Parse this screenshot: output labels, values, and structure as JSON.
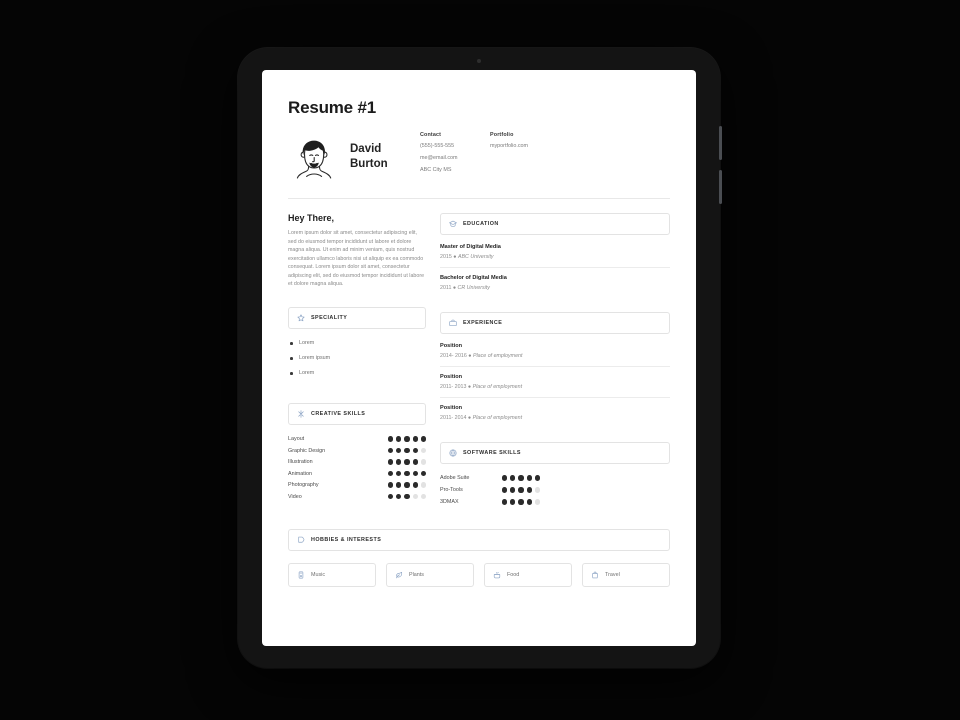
{
  "document": {
    "title": "Resume #1"
  },
  "header": {
    "avatar_alt": "avatar",
    "name_first": "David",
    "name_last": "Burton",
    "contact": {
      "heading": "Contact",
      "phone": "(555)-555-555",
      "email": "me@email.com",
      "address": "ABC City MS"
    },
    "portfolio": {
      "heading": "Portfolio",
      "url": "myportfolio.com"
    }
  },
  "intro": {
    "title": "Hey There,",
    "body": "Lorem ipsum dolor sit amet, consectetur adipiscing elit, sed do eiusmod tempor incididunt ut labore et dolore magna aliqua. Ut enim ad minim veniam, quis nostrud exercitation ullamco laboris nisi ut aliquip ex ea commodo consequat. Lorem ipsum dolor sit amet, consectetur adipiscing elit, sed do eiusmod tempor incididunt ut labore et dolore magna aliqua."
  },
  "education": {
    "label": "EDUCATION",
    "icon": "graduation-cap-icon",
    "entries": [
      {
        "degree": "Master of Digital Media",
        "year": "2015",
        "school": "ABC University"
      },
      {
        "degree": "Bachelor of Digital Media",
        "year": "2011",
        "school": "CR University"
      }
    ]
  },
  "experience": {
    "label": "EXPERIENCE",
    "icon": "briefcase-icon",
    "entries": [
      {
        "role": "Position",
        "years": "2014- 2016",
        "place": "Place of employment"
      },
      {
        "role": "Position",
        "years": "2011- 2013",
        "place": "Place of employment"
      },
      {
        "role": "Position",
        "years": "2011- 2014",
        "place": "Place of employment"
      }
    ]
  },
  "speciality": {
    "label": "SPECIALITY",
    "icon": "star-icon",
    "items": [
      "Lorem",
      "Lorem ipsum",
      "Lorem"
    ]
  },
  "creative_skills": {
    "label": "CREATIVE SKILLS",
    "icon": "spark-icon",
    "max": 5,
    "items": [
      {
        "name": "Layout",
        "value": 5
      },
      {
        "name": "Graphic Design",
        "value": 4
      },
      {
        "name": "Illustration",
        "value": 4
      },
      {
        "name": "Animation",
        "value": 5
      },
      {
        "name": "Photography",
        "value": 4
      },
      {
        "name": "Video",
        "value": 3
      }
    ]
  },
  "software_skills": {
    "label": "SOFTWARE SKILLS",
    "icon": "globe-icon",
    "max": 5,
    "items": [
      {
        "name": "Adobe Suite",
        "value": 5
      },
      {
        "name": "Pro-Tools",
        "value": 4
      },
      {
        "name": "3DMAX",
        "value": 4
      }
    ]
  },
  "hobbies": {
    "label": "HOBBIES & INTERESTS",
    "icon": "bookmark-icon",
    "items": [
      {
        "label": "Music",
        "icon": "music-player-icon"
      },
      {
        "label": "Plants",
        "icon": "leaf-icon"
      },
      {
        "label": "Food",
        "icon": "cooking-pot-icon"
      },
      {
        "label": "Travel",
        "icon": "bag-icon"
      }
    ]
  },
  "colors": {
    "accent_icon": "#8ba3c4",
    "dot_filled": "#2b2b2b",
    "dot_empty": "#e2e2e2",
    "device_bezel": "#141414",
    "page_background": "#050505"
  }
}
